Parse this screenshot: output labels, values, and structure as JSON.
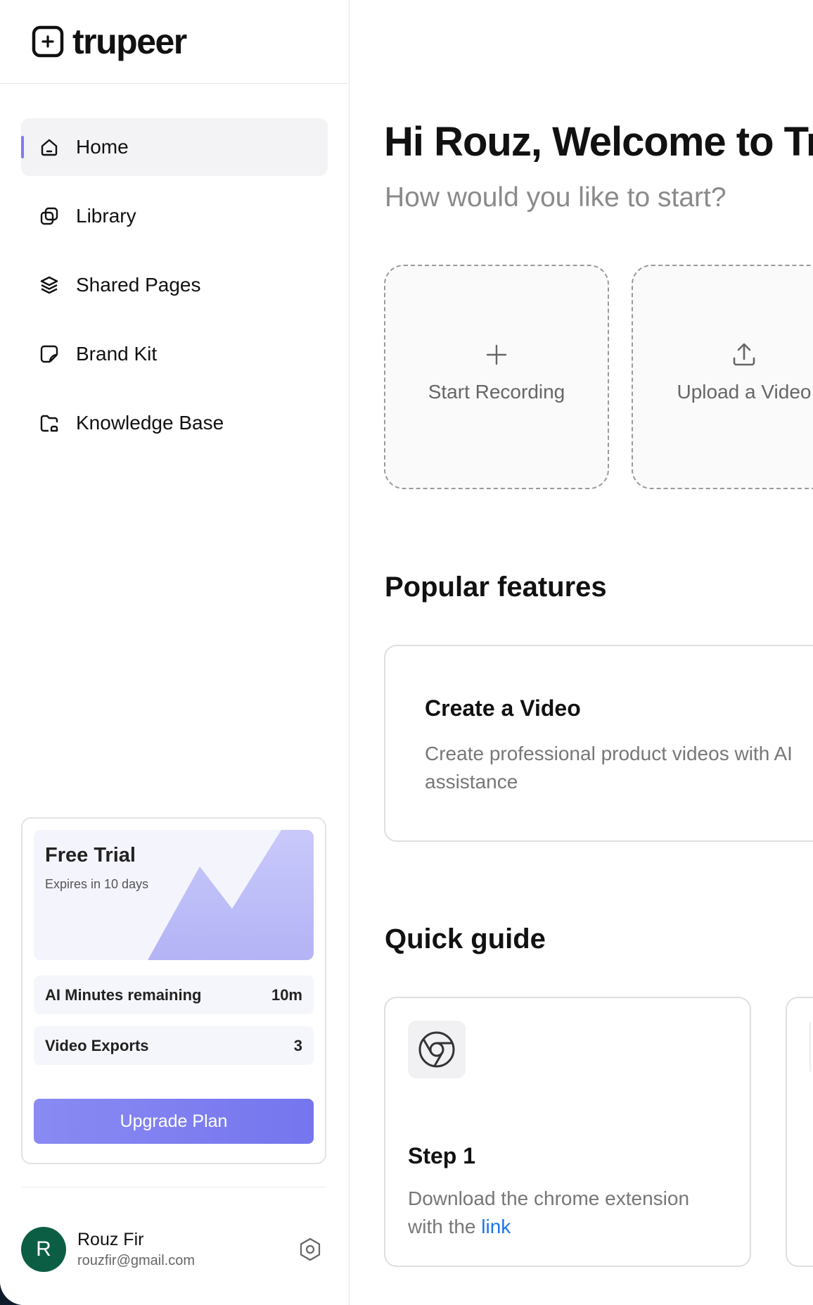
{
  "brand": {
    "name": "trupeer"
  },
  "nav": [
    {
      "label": "Home",
      "icon": "home-icon",
      "active": true
    },
    {
      "label": "Library",
      "icon": "library-icon",
      "active": false
    },
    {
      "label": "Shared Pages",
      "icon": "layers-icon",
      "active": false
    },
    {
      "label": "Brand Kit",
      "icon": "brand-kit-icon",
      "active": false
    },
    {
      "label": "Knowledge Base",
      "icon": "folder-icon",
      "active": false
    }
  ],
  "trial": {
    "title": "Free Trial",
    "subtitle": "Expires in 10 days",
    "stats": [
      {
        "label": "AI Minutes remaining",
        "value": "10m"
      },
      {
        "label": "Video Exports",
        "value": "3"
      }
    ],
    "upgrade_label": "Upgrade Plan"
  },
  "user": {
    "initial": "R",
    "name": "Rouz Fir",
    "email": "rouzfir@gmail.com"
  },
  "main": {
    "greeting": "Hi Rouz, Welcome to Tru",
    "subheading": "How would you like to start?",
    "actions": [
      {
        "label": "Start Recording",
        "icon": "plus-icon"
      },
      {
        "label": "Upload a Video",
        "icon": "upload-icon"
      }
    ],
    "popular_title": "Popular features",
    "feature": {
      "title": "Create a Video",
      "description": "Create professional product videos with AI assistance"
    },
    "quick_guide_title": "Quick guide",
    "guide": {
      "step": "Step 1",
      "description_prefix": "Download the chrome extension with the ",
      "link_text": "link",
      "icon": "chrome-icon"
    }
  },
  "colors": {
    "accent": "#7c7cf0",
    "avatar": "#0b5e44",
    "link": "#1a73e8"
  }
}
